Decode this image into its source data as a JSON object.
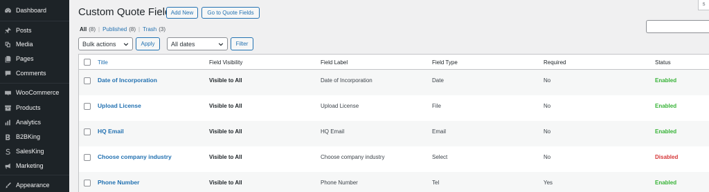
{
  "sidebar": {
    "items": [
      {
        "label": "Dashboard",
        "icon": "dashboard-icon"
      },
      {
        "label": "Posts",
        "icon": "pin-icon"
      },
      {
        "label": "Media",
        "icon": "media-icon"
      },
      {
        "label": "Pages",
        "icon": "pages-icon"
      },
      {
        "label": "Comments",
        "icon": "comment-icon"
      },
      {
        "label": "WooCommerce",
        "icon": "woocommerce-icon"
      },
      {
        "label": "Products",
        "icon": "archive-icon"
      },
      {
        "label": "Analytics",
        "icon": "bar-chart-icon"
      },
      {
        "label": "B2BKing",
        "icon": "b2bking-icon"
      },
      {
        "label": "SalesKing",
        "icon": "salesking-icon"
      },
      {
        "label": "Marketing",
        "icon": "megaphone-icon"
      },
      {
        "label": "Appearance",
        "icon": "brush-icon"
      }
    ]
  },
  "header": {
    "title": "Custom Quote Field",
    "add_new": "Add New",
    "go_to": "Go to Quote Fields",
    "corner": "S"
  },
  "views": {
    "all": "All",
    "all_count": "(8)",
    "published": "Published",
    "published_count": "(8)",
    "trash": "Trash",
    "trash_count": "(3)",
    "sep": "|"
  },
  "filters": {
    "bulk_actions": "Bulk actions",
    "apply": "Apply",
    "dates": "All dates",
    "filter": "Filter"
  },
  "table": {
    "columns": [
      "Title",
      "Field Visibility",
      "Field Label",
      "Field Type",
      "Required",
      "Status"
    ],
    "rows": [
      {
        "title": "Date of Incorporation",
        "visibility": "Visible to All",
        "label": "Date of Incorporation",
        "type": "Date",
        "required": "No",
        "status": "Enabled"
      },
      {
        "title": "Upload License",
        "visibility": "Visible to All",
        "label": "Upload License",
        "type": "File",
        "required": "No",
        "status": "Enabled"
      },
      {
        "title": "HQ Email",
        "visibility": "Visible to All",
        "label": "HQ Email",
        "type": "Email",
        "required": "No",
        "status": "Enabled"
      },
      {
        "title": "Choose company industry",
        "visibility": "Visible to All",
        "label": "Choose company industry",
        "type": "Select",
        "required": "No",
        "status": "Disabled"
      },
      {
        "title": "Phone Number",
        "visibility": "Visible to All",
        "label": "Phone Number",
        "type": "Tel",
        "required": "Yes",
        "status": "Enabled"
      }
    ]
  },
  "colors": {
    "enabled": "#36b336",
    "disabled": "#d63638",
    "link": "#2271b1"
  }
}
